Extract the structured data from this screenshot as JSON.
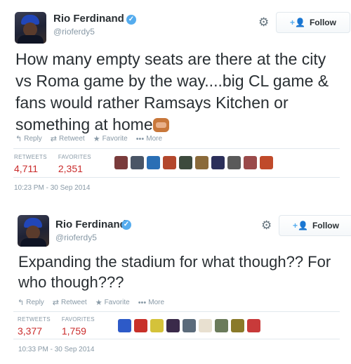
{
  "tweets": [
    {
      "name": "Rio Ferdinand",
      "handle": "@rioferdy5",
      "follow_label": "Follow",
      "text": "How many empty seats are there at the city vs Roma game by the way....big CL game & fans would rather Ramsays Kitchen or something at home",
      "actions": {
        "reply": "Reply",
        "retweet": "Retweet",
        "favorite": "Favorite",
        "more": "More"
      },
      "stats": {
        "retweets_label": "RETWEETS",
        "retweets": "4,711",
        "favorites_label": "FAVORITES",
        "favorites": "2,351"
      },
      "favoriter_colors": [
        "#7a3b3b",
        "#4a5566",
        "#2a6fb5",
        "#b3472c",
        "#3d4a3d",
        "#8a6a3a",
        "#2b2f5a",
        "#5a5a5a",
        "#9a4a4a",
        "#c04a2a"
      ],
      "timestamp": "10:23 PM - 30 Sep 2014"
    },
    {
      "name": "Rio Ferdinand",
      "handle": "@rioferdy5",
      "follow_label": "Follow",
      "text": "Expanding the stadium for what though?? For who though???",
      "actions": {
        "reply": "Reply",
        "retweet": "Retweet",
        "favorite": "Favorite",
        "more": "More"
      },
      "stats": {
        "retweets_label": "RETWEETS",
        "retweets": "3,377",
        "favorites_label": "FAVORITES",
        "favorites": "1,759"
      },
      "favoriter_colors": [
        "#2d5ac8",
        "#c8302a",
        "#d4c23a",
        "#3a2a4a",
        "#5b6b7b",
        "#e8e0d0",
        "#6b7b5b",
        "#8a7a2a",
        "#c83a3a"
      ],
      "timestamp": "10:33 PM - 30 Sep 2014"
    }
  ]
}
